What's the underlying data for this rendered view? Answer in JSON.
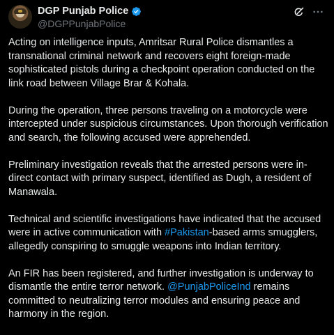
{
  "colors": {
    "background": "#000000",
    "text": "#e7e9ea",
    "secondary_text": "#71767b",
    "link": "#1d9bf0",
    "verified": "#1d9bf0"
  },
  "author": {
    "display_name": "DGP Punjab Police",
    "handle": "@DGPPunjabPolice",
    "verified_icon": "verified-badge-icon",
    "avatar": "profile-photo"
  },
  "actions": {
    "grok_icon": "grok-icon",
    "more_icon": "more-horizontal-icon",
    "more_label": "···"
  },
  "post": {
    "p1": "Acting on intelligence inputs, Amritsar Rural Police dismantles a transnational criminal network and recovers eight foreign-made sophisticated pistols during a checkpoint operation conducted on the link road between Village Brar & Kohala.",
    "p2": "During the operation, three persons traveling on a motorcycle were intercepted under suspicious circumstances. Upon thorough verification and search, the following accused were apprehended.",
    "p3": "Preliminary investigation reveals that the arrested persons were in-direct contact with primary suspect, identified as Dugh, a resident of Manawala.",
    "p4_before": "Technical and scientific investigations have indicated that the accused were in active communication with ",
    "p4_hashtag": "#Pakistan",
    "p4_after": "-based arms smugglers, allegedly conspiring to smuggle weapons into Indian territory.",
    "p5_before": "An FIR has been registered, and further investigation is underway to dismantle the entire terror network. ",
    "p5_mention": "@PunjabPoliceInd",
    "p5_after": " remains committed to neutralizing terror modules and ensuring peace and harmony in the region."
  }
}
